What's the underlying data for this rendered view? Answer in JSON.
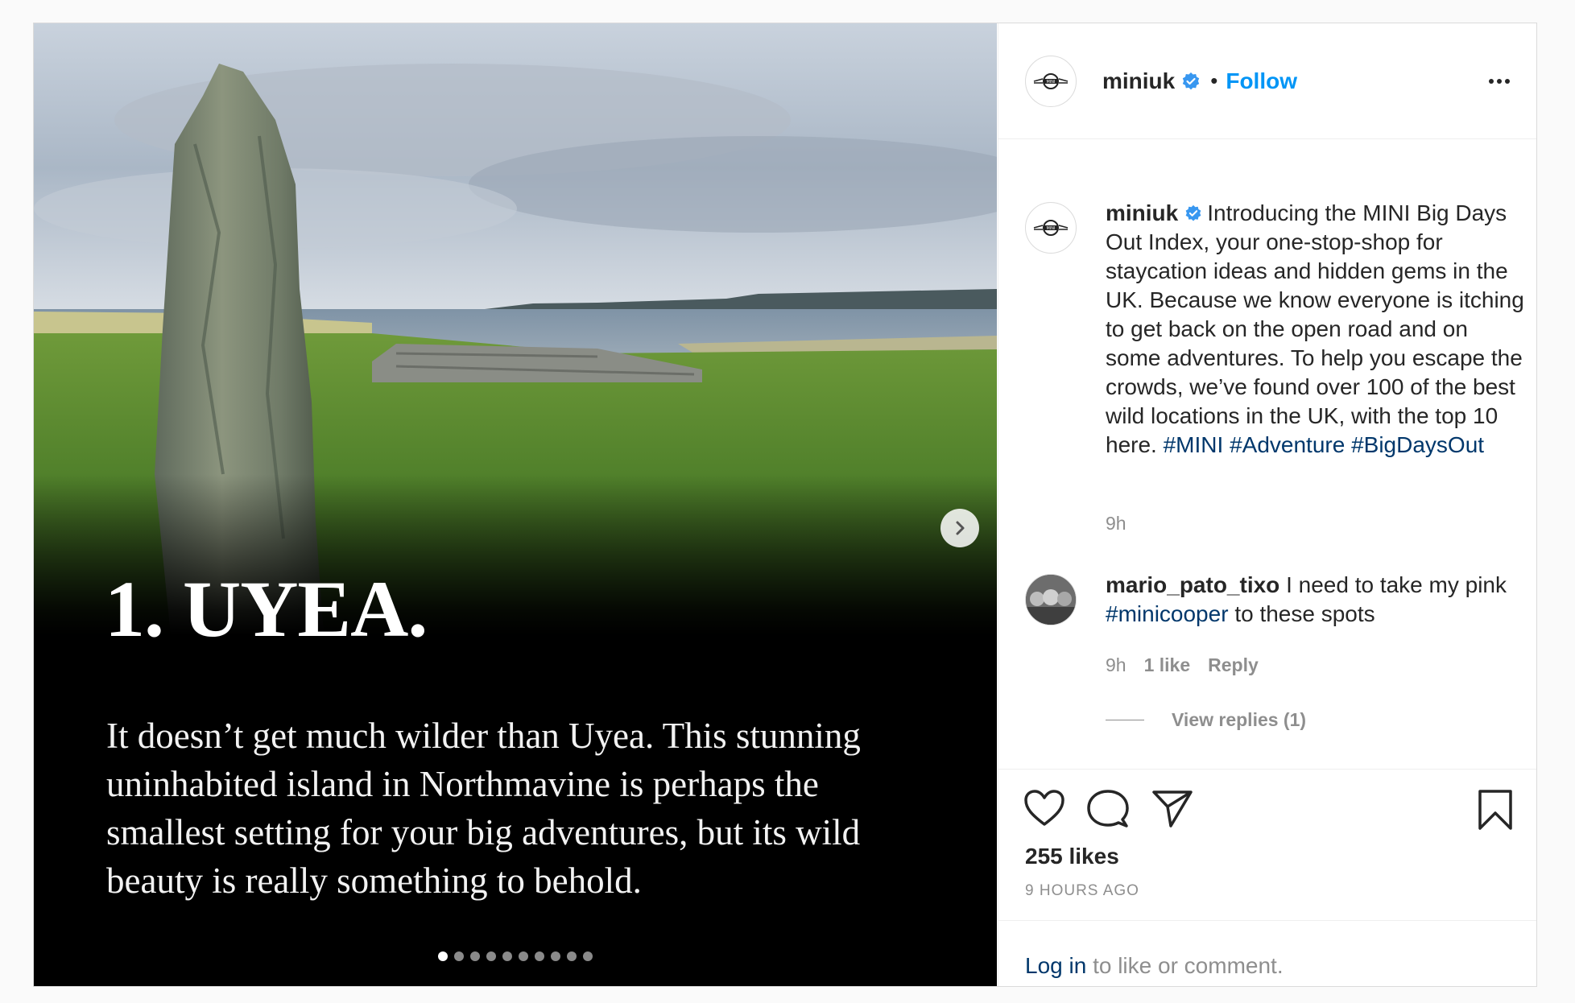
{
  "post": {
    "media": {
      "title": "1. UYEA.",
      "body": "It doesn’t get much wilder than Uyea. This stunning uninhabited island in Northmavine is  perhaps the smallest setting for your big adventures, but its wild beauty is really something to behold.",
      "slide_count": 10,
      "active_slide": 1,
      "next_icon": "chevron-right-icon"
    },
    "header": {
      "username": "miniuk",
      "separator": "•",
      "follow_label": "Follow",
      "more_icon": "more-options-icon",
      "avatar_icon": "mini-logo-icon",
      "verified_icon": "verified-badge-icon"
    },
    "caption": {
      "username": "miniuk",
      "text": "Introducing the MINI Big Days Out Index, your one-stop-shop for staycation ideas and hidden gems in the UK. Because we know everyone is itching to get back on the open road and on some adventures. To help you escape the crowds, we’ve found over 100 of the best wild locations in the UK, with the top 10 here.",
      "tags": [
        "#MINI",
        "#Adventure",
        "#BigDaysOut"
      ],
      "time": "9h"
    },
    "comment": {
      "username": "mario_pato_tixo",
      "text_before": "I need to take my pink",
      "tag": "#minicooper",
      "text_after": "to these spots",
      "time": "9h",
      "likes": "1 like",
      "reply_label": "Reply",
      "view_replies": "View replies (1)"
    },
    "actions": {
      "icons": [
        "heart-icon",
        "comment-icon",
        "share-icon",
        "bookmark-icon"
      ],
      "likes": "255 likes",
      "posted": "9 HOURS AGO"
    },
    "login_bar": {
      "login_label": "Log in",
      "rest": "to like or comment."
    },
    "colors": {
      "follow": "#0095f6",
      "hashtag": "#00376b",
      "verified": "#3897f0",
      "muted": "#8e8e8e"
    }
  }
}
